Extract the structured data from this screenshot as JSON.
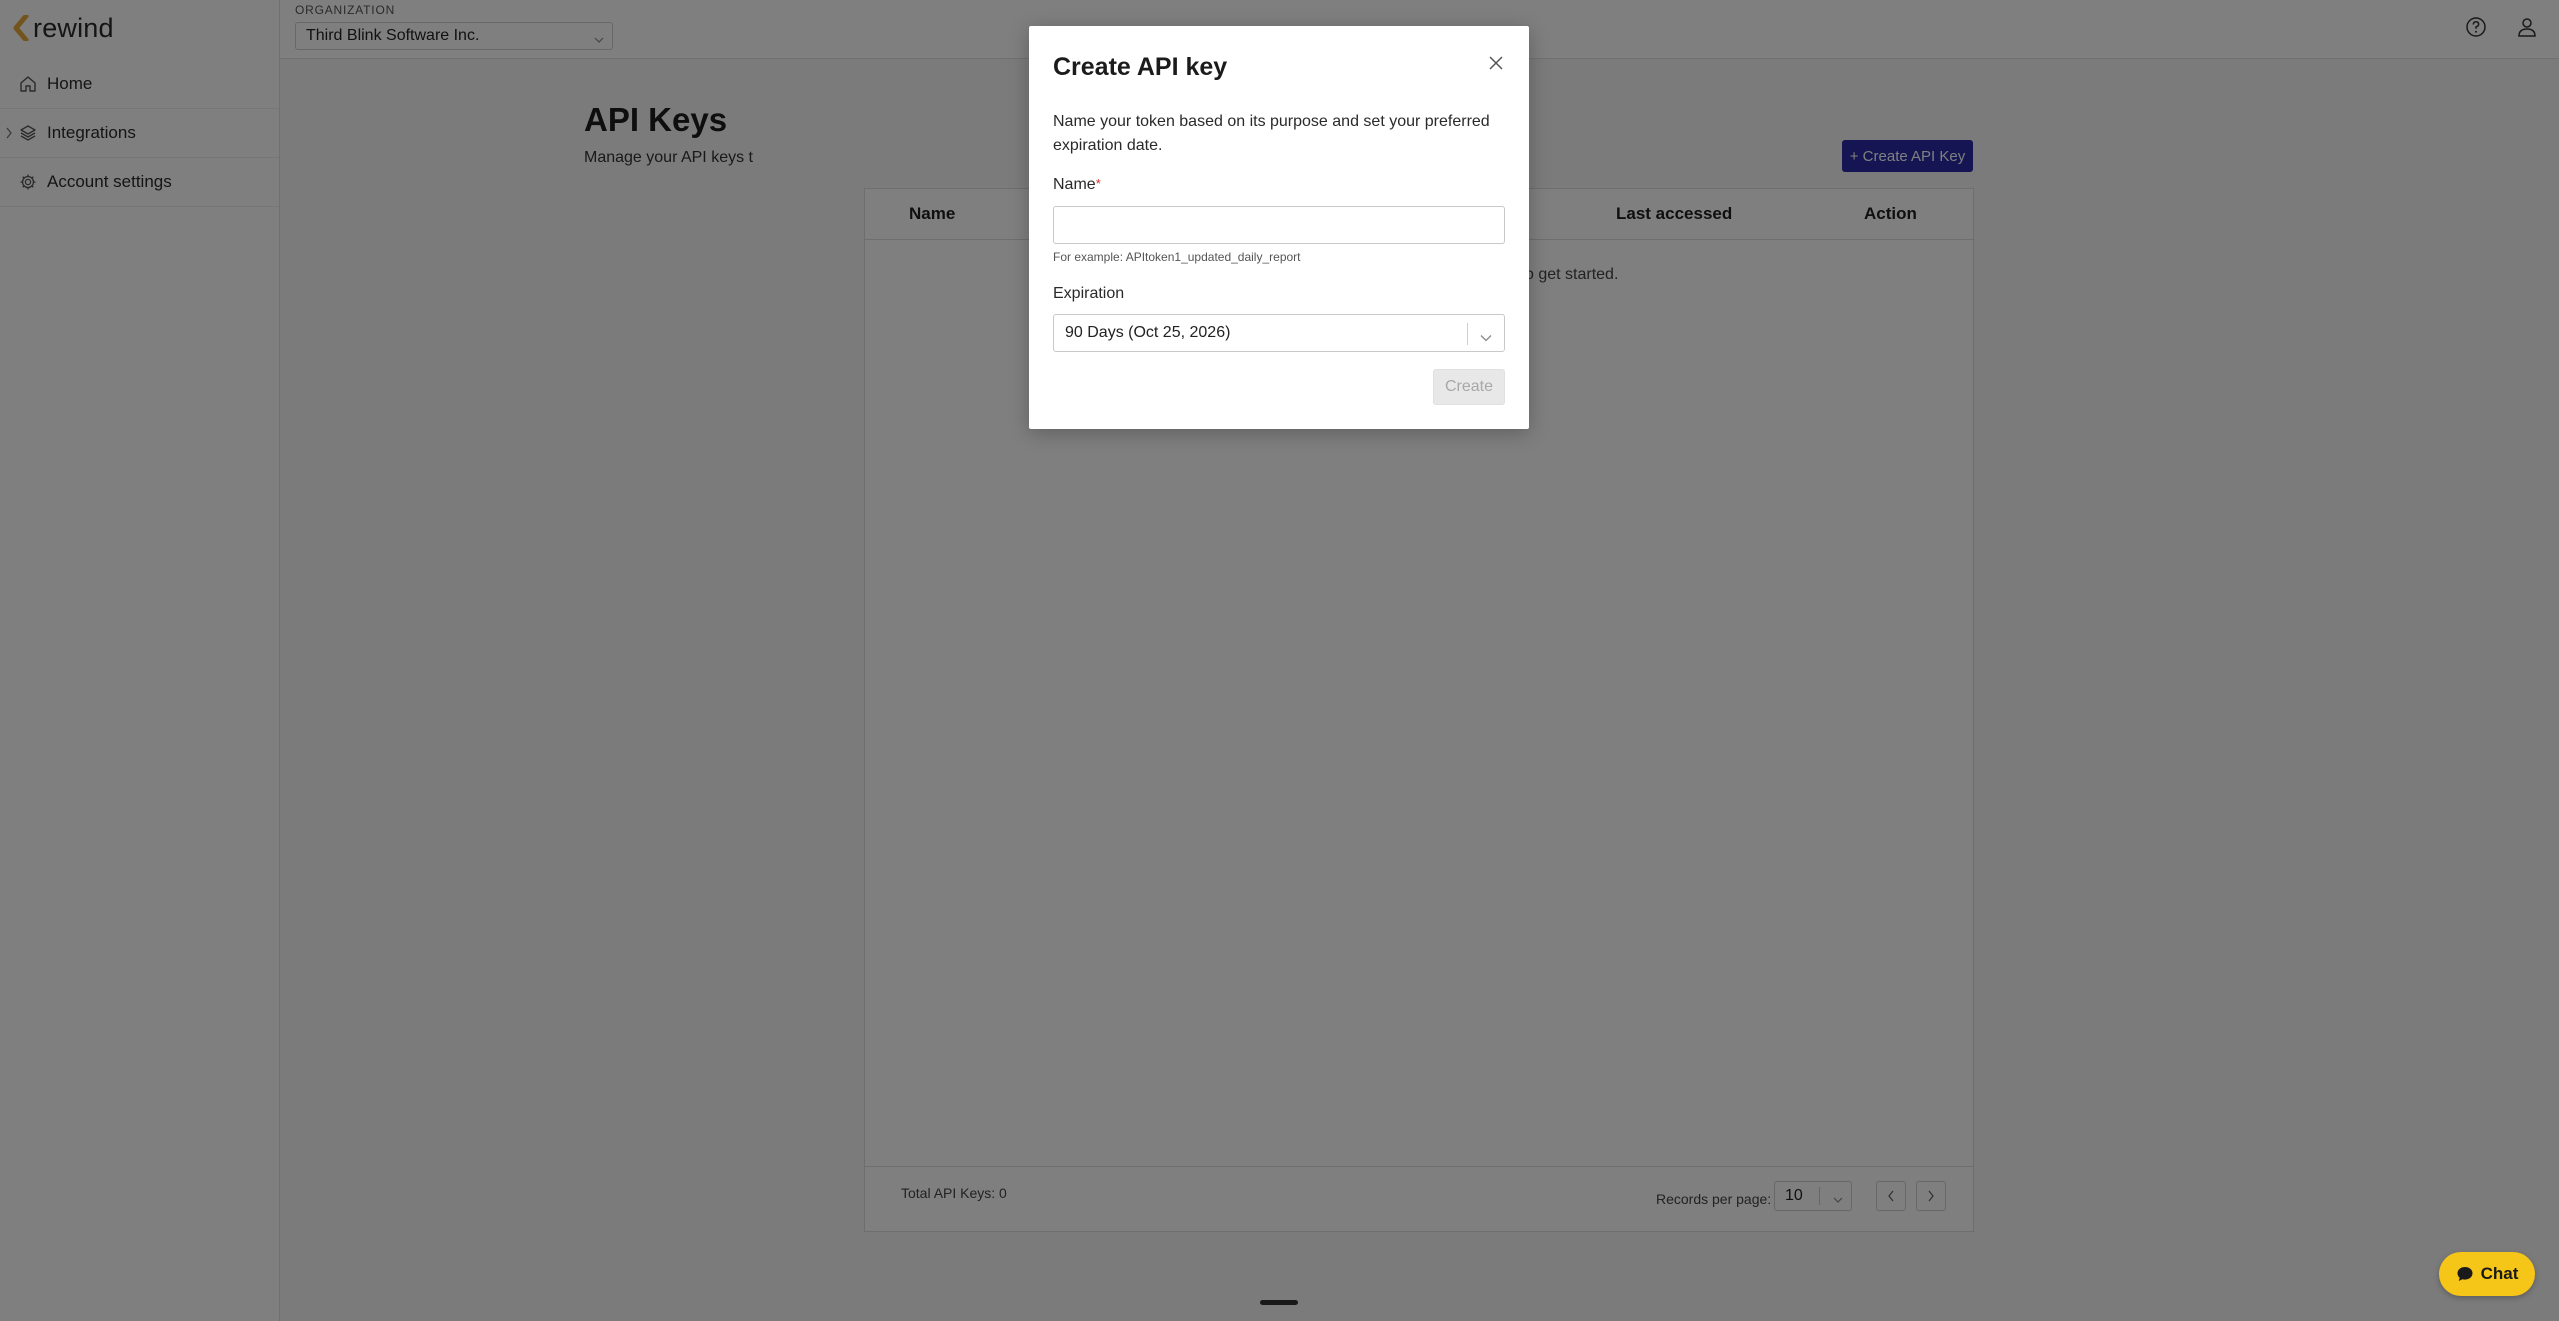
{
  "app": {
    "logo_text": "rewind",
    "brand_accent": "#e8a93b"
  },
  "sidebar": {
    "items": [
      {
        "label": "Home",
        "icon": "home-icon"
      },
      {
        "label": "Integrations",
        "icon": "layers-icon"
      },
      {
        "label": "Account settings",
        "icon": "gear-icon"
      }
    ]
  },
  "topbar": {
    "org_label": "ORGANIZATION",
    "org_value": "Third Blink Software Inc.",
    "help_icon": "help-icon",
    "user_icon": "user-icon"
  },
  "main": {
    "title": "API Keys",
    "subtitle": "Manage your API keys t",
    "create_button": "+ Create API Key",
    "table": {
      "columns": [
        "Name",
        "Last accessed",
        "Action"
      ],
      "empty_text": "o get started.",
      "total": "Total API Keys: 0",
      "records_per_page_label": "Records per page:",
      "records_per_page_value": "10"
    }
  },
  "modal": {
    "title": "Create API key",
    "description": "Name your token based on its purpose and set your preferred expiration date.",
    "name_label": "Name",
    "required_mark": "*",
    "name_value": "",
    "helper": "For example: APItoken1_updated_daily_report",
    "expiration_label": "Expiration",
    "expiration_value": "90 Days (Oct 25, 2026)",
    "create_label": "Create"
  },
  "chat": {
    "label": "Chat",
    "color": "#f5c518"
  },
  "colors": {
    "primary_button": "#2a2aa8",
    "overlay": "rgba(0,0,0,0.5)"
  }
}
